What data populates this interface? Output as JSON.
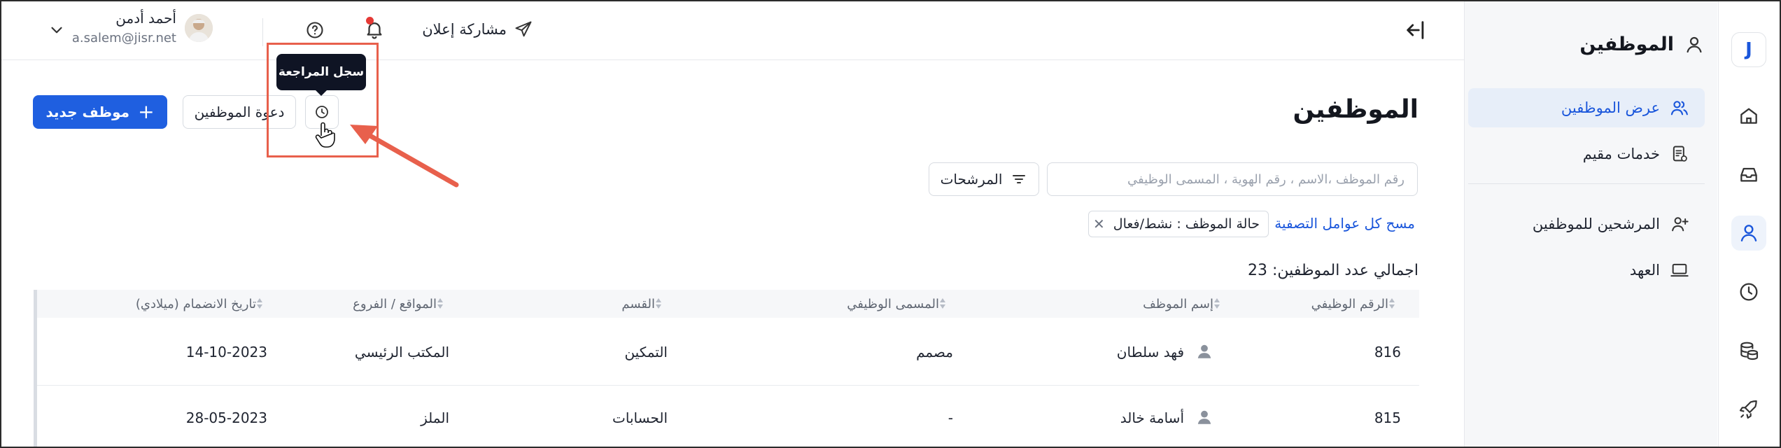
{
  "user": {
    "name": "أحمد أدمن",
    "email": "a.salem@jisr.net"
  },
  "topbar": {
    "share_label": "مشاركة إعلان"
  },
  "sidebar": {
    "title": "الموظفين",
    "items": [
      {
        "label": "عرض الموظفين"
      },
      {
        "label": "خدمات مقيم"
      },
      {
        "label": "المرشحين للموظفين"
      },
      {
        "label": "العهد"
      }
    ]
  },
  "rail": {
    "logo": "J"
  },
  "main": {
    "page_title": "الموظفين",
    "new_employee_label": "موظف جديد",
    "invite_label": "دعوة الموظفين",
    "tooltip": "سجل المراجعة",
    "search_placeholder": "رقم الموظف ،الاسم ، رقم الهوية ، المسمى الوظيفي",
    "filters_label": "المرشحات",
    "clear_filters_label": "مسح كل عوامل التصفية",
    "filter_chip": "حالة الموظف : نشط/فعال",
    "total_label": "اجمالي عدد الموظفين: 23"
  },
  "table": {
    "columns": [
      "الرقم الوظيفي",
      "إسم الموظف",
      "المسمى الوظيفي",
      "القسم",
      "المواقع / الفروع",
      "تاريخ الانضمام (ميلادي)"
    ],
    "rows": [
      {
        "id": "816",
        "name": "فهد سلطان",
        "title": "مصمم",
        "dept": "التمكين",
        "location": "المكتب الرئيسي",
        "date": "14-10-2023"
      },
      {
        "id": "815",
        "name": "أسامة خالد",
        "title": "-",
        "dept": "الحسابات",
        "location": "الملز",
        "date": "28-05-2023"
      }
    ]
  },
  "colors": {
    "primary": "#1f5fe0",
    "annotation": "#e8604c",
    "tooltip_bg": "#0f1424"
  }
}
